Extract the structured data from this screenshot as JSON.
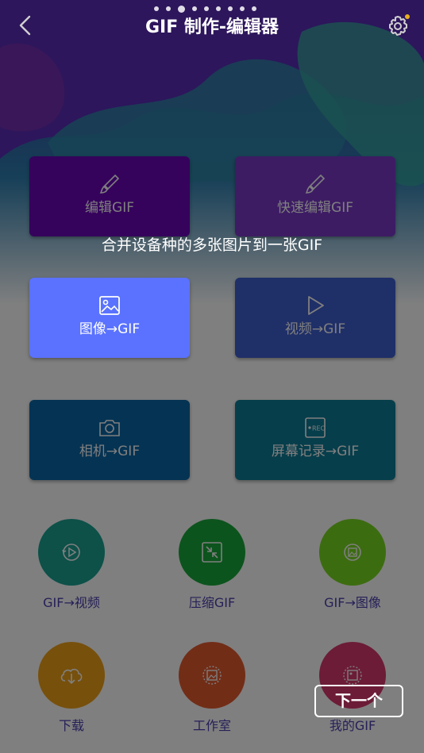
{
  "header": {
    "title": "GIF 制作-编辑器",
    "page_indicator": {
      "count": 9,
      "active_index": 2
    }
  },
  "tiles": [
    {
      "label": "编辑GIF",
      "icon": "brush-icon"
    },
    {
      "label": "快速编辑GIF",
      "icon": "brush-icon"
    },
    {
      "label": "图像→GIF",
      "icon": "image-icon"
    },
    {
      "label": "视频→GIF",
      "icon": "play-icon"
    },
    {
      "label": "相机→GIF",
      "icon": "camera-icon"
    },
    {
      "label": "屏幕记录→GIF",
      "icon": "rec-icon"
    }
  ],
  "round_buttons": [
    {
      "label": "GIF→视频",
      "icon": "video-convert-icon",
      "color": "#1aa392"
    },
    {
      "label": "压缩GIF",
      "icon": "compress-icon",
      "color": "#18a83a"
    },
    {
      "label": "GIF→图像",
      "icon": "image-convert-icon",
      "color": "#78d820"
    },
    {
      "label": "下载",
      "icon": "cloud-download-icon",
      "color": "#efa018"
    },
    {
      "label": "工作室",
      "icon": "studio-icon",
      "color": "#e55a2e"
    },
    {
      "label": "我的GIF",
      "icon": "my-gif-icon",
      "color": "#d8386c"
    }
  ],
  "tutorial": {
    "tip": "合并设备种的多张图片到一张GIF",
    "next_label": "下一个"
  }
}
